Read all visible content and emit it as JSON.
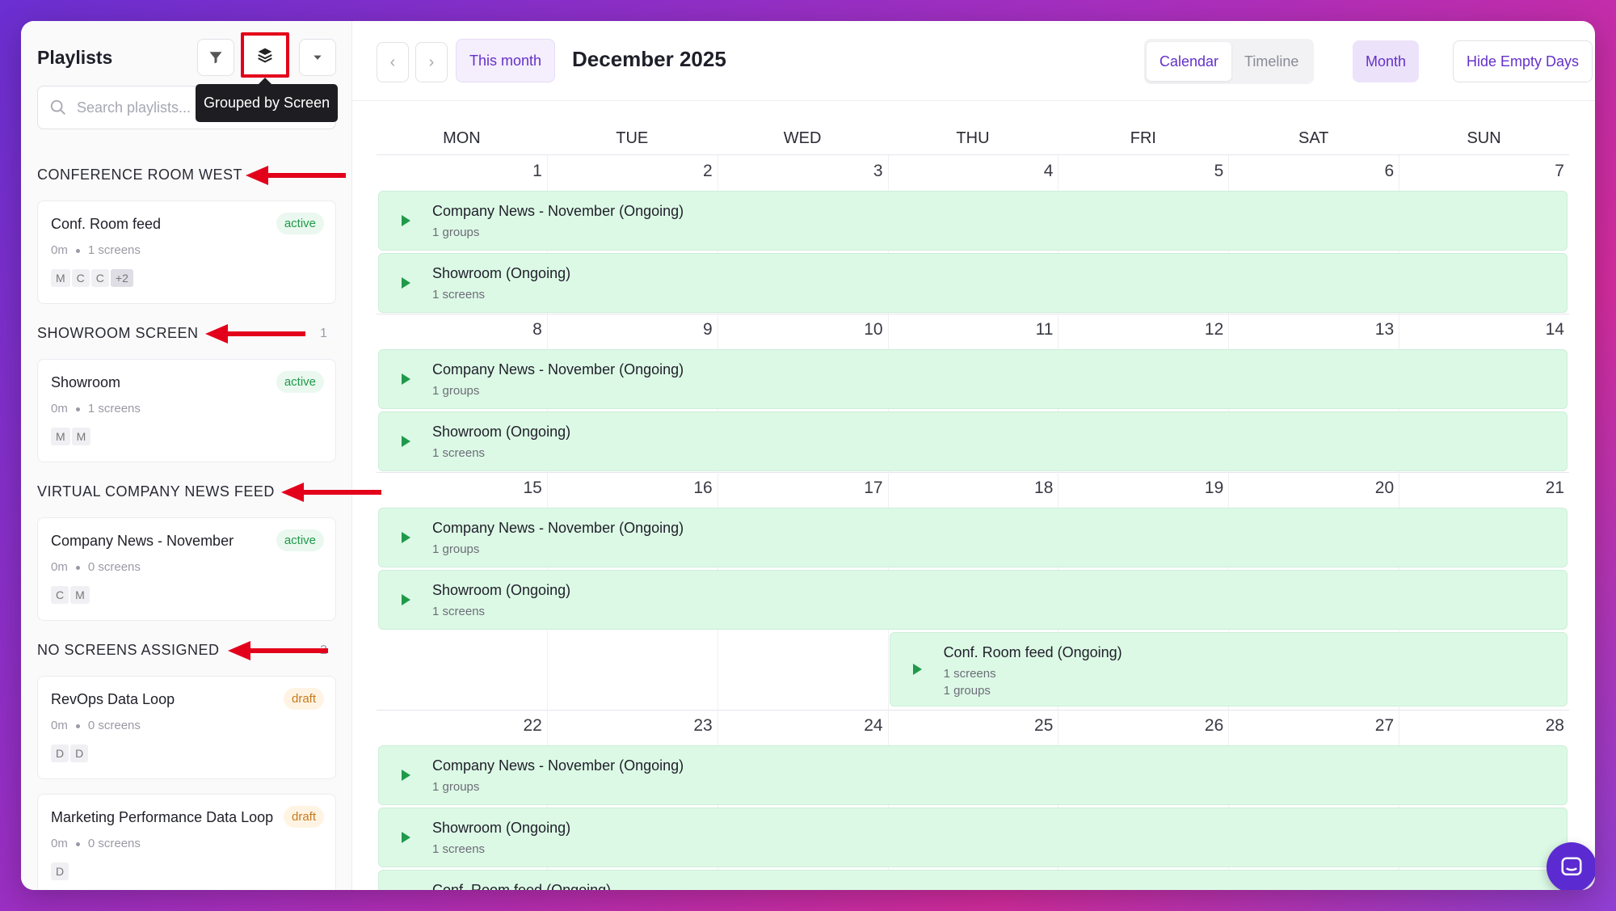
{
  "sidebar": {
    "title": "Playlists",
    "tooltip": "Grouped by Screen",
    "search_placeholder": "Search playlists...",
    "groups": [
      {
        "name": "CONFERENCE ROOM WEST",
        "count": "",
        "playlists": [
          {
            "name": "Conf. Room feed",
            "status": "active",
            "duration": "0m",
            "screens": "1 screens",
            "tags": [
              "M",
              "C",
              "C",
              "+2"
            ]
          }
        ]
      },
      {
        "name": "SHOWROOM SCREEN",
        "count": "1",
        "playlists": [
          {
            "name": "Showroom",
            "status": "active",
            "duration": "0m",
            "screens": "1 screens",
            "tags": [
              "M",
              "M"
            ]
          }
        ]
      },
      {
        "name": "VIRTUAL COMPANY NEWS FEED",
        "count": "",
        "playlists": [
          {
            "name": "Company News - November",
            "status": "active",
            "duration": "0m",
            "screens": "0 screens",
            "tags": [
              "C",
              "M"
            ]
          }
        ]
      },
      {
        "name": "NO SCREENS ASSIGNED",
        "count": "2",
        "playlists": [
          {
            "name": "RevOps Data Loop",
            "status": "draft",
            "duration": "0m",
            "screens": "0 screens",
            "tags": [
              "D",
              "D"
            ]
          },
          {
            "name": "Marketing Performance Data Loop",
            "status": "draft",
            "duration": "0m",
            "screens": "0 screens",
            "tags": [
              "D"
            ]
          }
        ]
      }
    ]
  },
  "toolbar": {
    "prev": "‹",
    "next": "›",
    "this_month": "This month",
    "title": "December 2025",
    "view_calendar": "Calendar",
    "view_timeline": "Timeline",
    "month": "Month",
    "hide_empty": "Hide Empty Days"
  },
  "calendar": {
    "days_of_week": [
      "MON",
      "TUE",
      "WED",
      "THU",
      "FRI",
      "SAT",
      "SUN"
    ],
    "weeks": [
      {
        "days": [
          "1",
          "2",
          "3",
          "4",
          "5",
          "6",
          "7"
        ],
        "events": [
          {
            "title": "Company News - November (Ongoing)",
            "lines": [
              "1 groups"
            ]
          },
          {
            "title": "Showroom (Ongoing)",
            "lines": [
              "1 screens"
            ]
          }
        ]
      },
      {
        "days": [
          "8",
          "9",
          "10",
          "11",
          "12",
          "13",
          "14"
        ],
        "events": [
          {
            "title": "Company News - November (Ongoing)",
            "lines": [
              "1 groups"
            ]
          },
          {
            "title": "Showroom (Ongoing)",
            "lines": [
              "1 screens"
            ]
          }
        ]
      },
      {
        "days": [
          "15",
          "16",
          "17",
          "18",
          "19",
          "20",
          "21"
        ],
        "events": [
          {
            "title": "Company News - November (Ongoing)",
            "lines": [
              "1 groups"
            ]
          },
          {
            "title": "Showroom (Ongoing)",
            "lines": [
              "1 screens"
            ]
          },
          {
            "title": "Conf. Room feed (Ongoing)",
            "lines": [
              "1 screens",
              "1 groups"
            ]
          }
        ]
      },
      {
        "days": [
          "22",
          "23",
          "24",
          "25",
          "26",
          "27",
          "28"
        ],
        "events": [
          {
            "title": "Company News - November (Ongoing)",
            "lines": [
              "1 groups"
            ]
          },
          {
            "title": "Showroom (Ongoing)",
            "lines": [
              "1 screens"
            ]
          },
          {
            "title": "Conf. Room feed (Ongoing)",
            "lines": []
          }
        ]
      }
    ]
  },
  "colors": {
    "accent": "#6431c9",
    "event_bg": "#dcf9e6",
    "play": "#1f9a4a",
    "highlight": "#e3001b"
  }
}
